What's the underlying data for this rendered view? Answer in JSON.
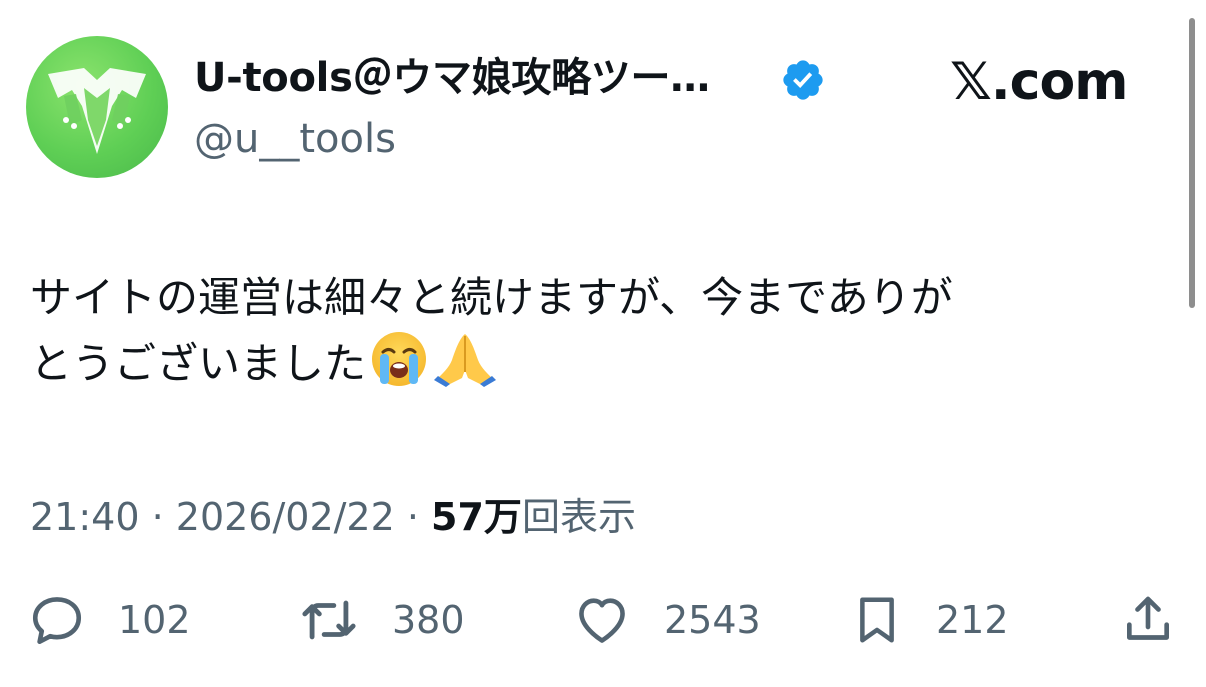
{
  "author": {
    "display_name": "U-tools＠ウマ娘攻略ツー…",
    "handle": "@u__tools",
    "avatar_icon": "u-tools-logo-icon",
    "verified_icon": "verified-badge-icon",
    "verified_color": "#1d9bf0"
  },
  "brand": {
    "label": "𝕏.com"
  },
  "tweet": {
    "line1": "サイトの運営は細々と続けますが、今までありが",
    "line2": "とうございました",
    "emojis": [
      "loudly-crying-face-icon",
      "folded-hands-icon"
    ]
  },
  "meta": {
    "time": "21:40",
    "separator1": " · ",
    "date": "2026/02/22",
    "separator2": " · ",
    "views_count": "57万",
    "views_label": "回表示"
  },
  "actions": {
    "reply": {
      "icon": "reply-icon",
      "count": "102"
    },
    "repost": {
      "icon": "repost-icon",
      "count": "380"
    },
    "like": {
      "icon": "heart-icon",
      "count": "2543"
    },
    "bookmark": {
      "icon": "bookmark-icon",
      "count": "212"
    },
    "share": {
      "icon": "share-icon"
    }
  },
  "colors": {
    "text_primary": "#0f1419",
    "text_secondary": "#536471",
    "avatar_green": "#5fcf55"
  }
}
